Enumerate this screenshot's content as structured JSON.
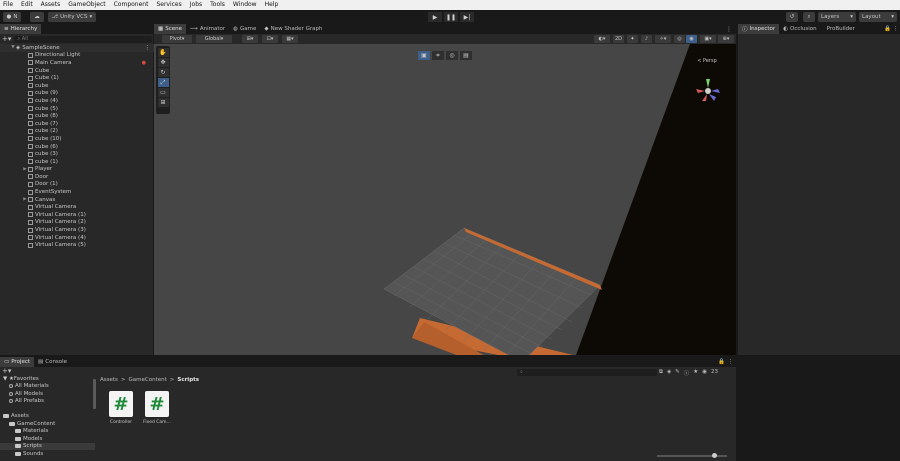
{
  "menu": [
    "File",
    "Edit",
    "Assets",
    "GameObject",
    "Component",
    "Services",
    "Jobs",
    "Tools",
    "Window",
    "Help"
  ],
  "toolbar": {
    "account": "N",
    "vcs": "Unity VCS",
    "layers": "Layers",
    "layout": "Layout"
  },
  "hierarchy": {
    "tab": "Hierarchy",
    "search_placeholder": "All",
    "scene": "SampleScene",
    "items": [
      {
        "label": "Directional Light",
        "expand": false
      },
      {
        "label": "Main Camera",
        "expand": false
      },
      {
        "label": "Cube",
        "expand": false
      },
      {
        "label": "Cube (1)",
        "expand": false
      },
      {
        "label": "cube",
        "expand": false
      },
      {
        "label": "cube (9)",
        "expand": false
      },
      {
        "label": "cube (4)",
        "expand": false
      },
      {
        "label": "cube (5)",
        "expand": false
      },
      {
        "label": "cube (8)",
        "expand": false
      },
      {
        "label": "cube (7)",
        "expand": false
      },
      {
        "label": "cube (2)",
        "expand": false
      },
      {
        "label": "cube (10)",
        "expand": false
      },
      {
        "label": "cube (6)",
        "expand": false
      },
      {
        "label": "cube (3)",
        "expand": false
      },
      {
        "label": "cube (1)",
        "expand": false
      },
      {
        "label": "Player",
        "expand": true
      },
      {
        "label": "Door",
        "expand": false
      },
      {
        "label": "Door (1)",
        "expand": false
      },
      {
        "label": "EventSystem",
        "expand": false
      },
      {
        "label": "Canvas",
        "expand": true
      },
      {
        "label": "Virtual Camera",
        "expand": false
      },
      {
        "label": "Virtual Camera (1)",
        "expand": false
      },
      {
        "label": "Virtual Camera (2)",
        "expand": false
      },
      {
        "label": "Virtual Camera (3)",
        "expand": false
      },
      {
        "label": "Virtual Camera (4)",
        "expand": false
      },
      {
        "label": "Virtual Camera (5)",
        "expand": false
      }
    ]
  },
  "scene_tabs": [
    "Scene",
    "Animator",
    "Game",
    "New Shader Graph"
  ],
  "scene_toolbar": {
    "pivot": "Pivot",
    "global": "Global",
    "mode_2d": "2D",
    "persp": "< Persp"
  },
  "inspector_tabs": [
    "Inspector",
    "Occlusion",
    "ProBuilder"
  ],
  "project": {
    "tabs": [
      "Project",
      "Console"
    ],
    "tree": [
      {
        "label": "Favorites",
        "kind": "star",
        "indent": 0
      },
      {
        "label": "All Materials",
        "kind": "search",
        "indent": 1
      },
      {
        "label": "All Models",
        "kind": "search",
        "indent": 1
      },
      {
        "label": "All Prefabs",
        "kind": "search",
        "indent": 1
      },
      {
        "label": "",
        "kind": "blank",
        "indent": 0
      },
      {
        "label": "Assets",
        "kind": "folder",
        "indent": 0
      },
      {
        "label": "GameContent",
        "kind": "folder",
        "indent": 1
      },
      {
        "label": "Materials",
        "kind": "folder",
        "indent": 2
      },
      {
        "label": "Models",
        "kind": "folder",
        "indent": 2
      },
      {
        "label": "Scripts",
        "kind": "folder",
        "indent": 2
      },
      {
        "label": "Sounds",
        "kind": "folder",
        "indent": 2
      }
    ],
    "breadcrumb": [
      "Assets",
      "GameContent",
      "Scripts"
    ],
    "assets": [
      {
        "label": "Controller",
        "icon": "#"
      },
      {
        "label": "Fixed Cam...",
        "icon": "#"
      }
    ],
    "count": "23"
  },
  "colors": {
    "accent": "#3d5f8a",
    "orange": "#c8672f",
    "script_green": "#1f8a3a"
  }
}
